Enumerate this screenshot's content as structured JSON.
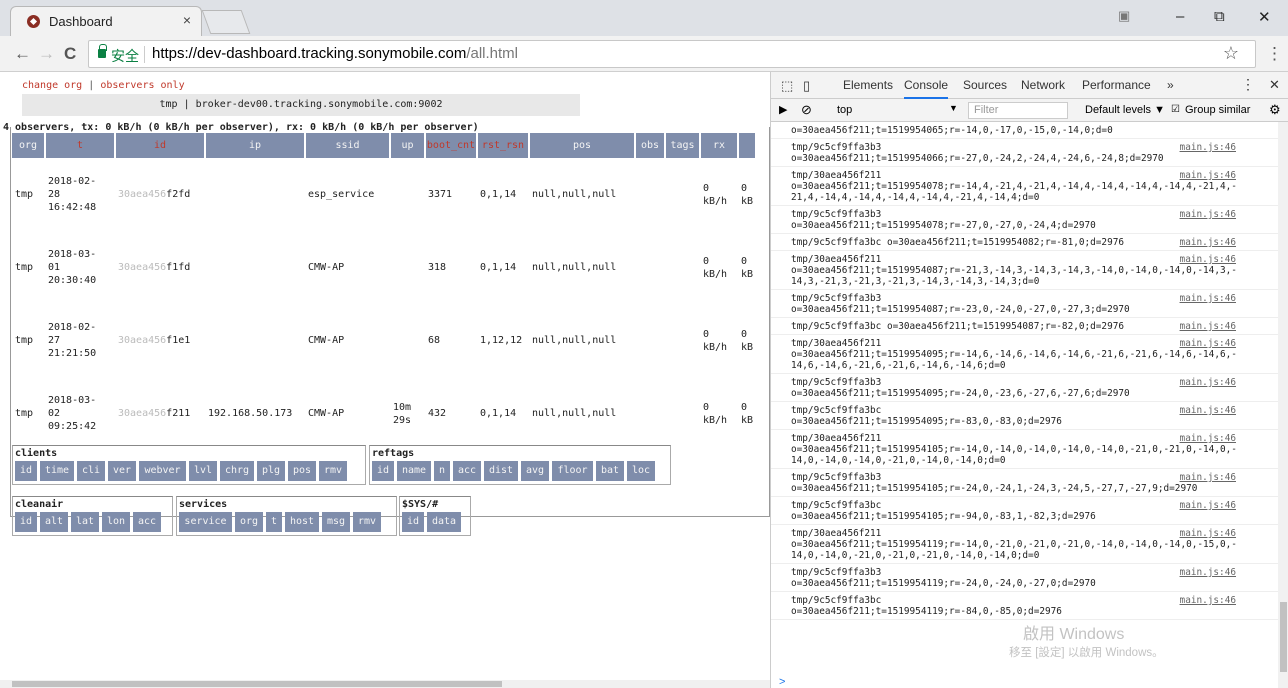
{
  "browser": {
    "tab_title": "Dashboard",
    "tab_close": "×",
    "secure_label": "安全",
    "url_host": "https://dev-dashboard.tracking.sonymobile.com",
    "url_path": "/all.html",
    "back": "←",
    "forward": "→",
    "reload": "C",
    "star": "☆",
    "menu": "⋮",
    "minimize": "–",
    "restore": "⧉",
    "close": "✕"
  },
  "page": {
    "link_change_org": "change org",
    "link_separator": "|",
    "link_observers_only": "observers only",
    "broker_bar": "tmp | broker-dev00.tracking.sonymobile.com:9002",
    "summary": "4 observers, tx: 0 kB/h (0 kB/h per observer), rx: 0 kB/h (0 kB/h per observer)",
    "columns": [
      "org",
      "t",
      "id",
      "ip",
      "ssid",
      "up",
      "boot_cnt",
      "rst_rsn",
      "pos",
      "obs",
      "tags",
      "rx"
    ],
    "rows": [
      {
        "org": "tmp",
        "t": "2018-02-\n28\n16:42:48",
        "id_dim": "30aea456",
        "id": "f2fd",
        "ip": "",
        "ssid": "esp_service",
        "up": "",
        "boot_cnt": "3371",
        "rst_rsn": "0,1,14",
        "pos": "null,null,null",
        "rx": "0\nkB/h",
        "tx": "0\nkB"
      },
      {
        "org": "tmp",
        "t": "2018-03-\n01\n20:30:40",
        "id_dim": "30aea456",
        "id": "f1fd",
        "ip": "",
        "ssid": "CMW-AP",
        "up": "",
        "boot_cnt": "318",
        "rst_rsn": "0,1,14",
        "pos": "null,null,null",
        "rx": "0\nkB/h",
        "tx": "0\nkB"
      },
      {
        "org": "tmp",
        "t": "2018-02-\n27\n21:21:50",
        "id_dim": "30aea456",
        "id": "f1e1",
        "ip": "",
        "ssid": "CMW-AP",
        "up": "",
        "boot_cnt": "68",
        "rst_rsn": "1,12,12",
        "pos": "null,null,null",
        "rx": "0\nkB/h",
        "tx": "0\nkB"
      },
      {
        "org": "tmp",
        "t": "2018-03-\n02\n09:25:42",
        "id_dim": "30aea456",
        "id": "f211",
        "ip": "192.168.50.173",
        "ssid": "CMW-AP",
        "up": "10m\n29s",
        "boot_cnt": "432",
        "rst_rsn": "0,1,14",
        "pos": "null,null,null",
        "rx": "0\nkB/h",
        "tx": "0\nkB"
      }
    ],
    "groups": {
      "clients": {
        "title": "clients",
        "fields": [
          "id",
          "time",
          "cli",
          "ver",
          "webver",
          "lvl",
          "chrg",
          "plg",
          "pos",
          "rmv"
        ]
      },
      "reftags": {
        "title": "reftags",
        "fields": [
          "id",
          "name",
          "n",
          "acc",
          "dist",
          "avg",
          "floor",
          "bat",
          "loc"
        ]
      },
      "cleanair": {
        "title": "cleanair",
        "fields": [
          "id",
          "alt",
          "lat",
          "lon",
          "acc"
        ]
      },
      "services": {
        "title": "services",
        "fields": [
          "service",
          "org",
          "t",
          "host",
          "msg",
          "rmv"
        ]
      },
      "sys": {
        "title": "$SYS/#",
        "fields": [
          "id",
          "data"
        ]
      }
    }
  },
  "devtools": {
    "tabs": [
      "Elements",
      "Console",
      "Sources",
      "Network",
      "Performance",
      "»"
    ],
    "context": "top",
    "filter_placeholder": "Filter",
    "levels": "Default levels ▼",
    "group_similar": "Group similar",
    "logs": [
      {
        "msg": "o=30aea456f211;t=1519954065;r=-14,0,-17,0,-15,0,-14,0;d=0",
        "src": ""
      },
      {
        "msg": "tmp/9c5cf9ffa3b3\no=30aea456f211;t=1519954066;r=-27,0,-24,2,-24,4,-24,6,-24,8;d=2970",
        "src": "main.js:46"
      },
      {
        "msg": "tmp/30aea456f211\no=30aea456f211;t=1519954078;r=-14,4,-21,4,-21,4,-14,4,-14,4,-14,4,-14,4,-21,4,-21,4,-14,4,-14,4,-14,4,-14,4,-21,4,-14,4;d=0",
        "src": "main.js:46"
      },
      {
        "msg": "tmp/9c5cf9ffa3b3\no=30aea456f211;t=1519954078;r=-27,0,-27,0,-24,4;d=2970",
        "src": "main.js:46"
      },
      {
        "msg": "tmp/9c5cf9ffa3bc o=30aea456f211;t=1519954082;r=-81,0;d=2976",
        "src": "main.js:46"
      },
      {
        "msg": "tmp/30aea456f211\no=30aea456f211;t=1519954087;r=-21,3,-14,3,-14,3,-14,3,-14,0,-14,0,-14,0,-14,3,-14,3,-21,3,-21,3,-21,3,-14,3,-14,3,-14,3;d=0",
        "src": "main.js:46"
      },
      {
        "msg": "tmp/9c5cf9ffa3b3\no=30aea456f211;t=1519954087;r=-23,0,-24,0,-27,0,-27,3;d=2970",
        "src": "main.js:46"
      },
      {
        "msg": "tmp/9c5cf9ffa3bc o=30aea456f211;t=1519954087;r=-82,0;d=2976",
        "src": "main.js:46"
      },
      {
        "msg": "tmp/30aea456f211\no=30aea456f211;t=1519954095;r=-14,6,-14,6,-14,6,-14,6,-21,6,-21,6,-14,6,-14,6,-14,6,-14,6,-21,6,-21,6,-14,6,-14,6;d=0",
        "src": "main.js:46"
      },
      {
        "msg": "tmp/9c5cf9ffa3b3\no=30aea456f211;t=1519954095;r=-24,0,-23,6,-27,6,-27,6;d=2970",
        "src": "main.js:46"
      },
      {
        "msg": "tmp/9c5cf9ffa3bc\no=30aea456f211;t=1519954095;r=-83,0,-83,0;d=2976",
        "src": "main.js:46"
      },
      {
        "msg": "tmp/30aea456f211\no=30aea456f211;t=1519954105;r=-14,0,-14,0,-14,0,-14,0,-14,0,-21,0,-21,0,-14,0,-14,0,-14,0,-14,0,-21,0,-14,0,-14,0;d=0",
        "src": "main.js:46"
      },
      {
        "msg": "tmp/9c5cf9ffa3b3\no=30aea456f211;t=1519954105;r=-24,0,-24,1,-24,3,-24,5,-27,7,-27,9;d=2970",
        "src": "main.js:46"
      },
      {
        "msg": "tmp/9c5cf9ffa3bc\no=30aea456f211;t=1519954105;r=-94,0,-83,1,-82,3;d=2976",
        "src": "main.js:46"
      },
      {
        "msg": "tmp/30aea456f211\no=30aea456f211;t=1519954119;r=-14,0,-21,0,-21,0,-21,0,-14,0,-14,0,-14,0,-15,0,-14,0,-14,0,-21,0,-21,0,-21,0,-14,0,-14,0;d=0",
        "src": "main.js:46"
      },
      {
        "msg": "tmp/9c5cf9ffa3b3\no=30aea456f211;t=1519954119;r=-24,0,-24,0,-27,0;d=2970",
        "src": "main.js:46"
      },
      {
        "msg": "tmp/9c5cf9ffa3bc\no=30aea456f211;t=1519954119;r=-84,0,-85,0;d=2976",
        "src": "main.js:46"
      }
    ],
    "prompt": ">",
    "watermark_line1": "啟用 Windows",
    "watermark_line2": "移至 [設定] 以啟用 Windows。"
  },
  "colors": {
    "header_bg": "#7f8dab",
    "header_highlight": "#c0392b",
    "link": "#c0392b",
    "secure": "#0b8043"
  }
}
